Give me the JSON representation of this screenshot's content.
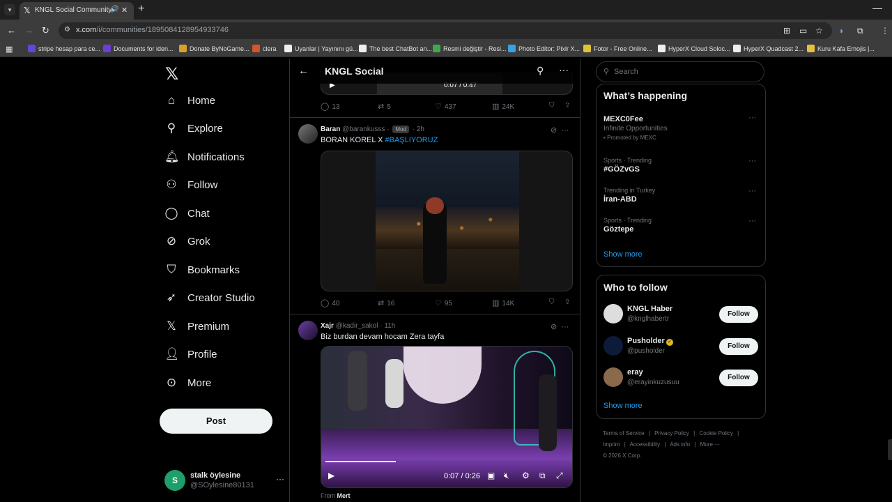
{
  "browser": {
    "tab_title": "KNGL Social Community / X",
    "url_host": "x.com",
    "url_path": "/i/communities/1895084128954933746",
    "bookmarks": [
      {
        "label": "stripe hesap para ce...",
        "color": "#5b4bd6"
      },
      {
        "label": "Documents for iden...",
        "color": "#6b3fd4"
      },
      {
        "label": "Donate ByNoGame...",
        "color": "#d9a12a"
      },
      {
        "label": "clera",
        "color": "#d4552a"
      },
      {
        "label": "Uyanlar | Yayınını gü...",
        "color": "#eeeeee"
      },
      {
        "label": "The best ChatBot an...",
        "color": "#eeeeee"
      },
      {
        "label": "Resmi değiştir - Resi...",
        "color": "#3fa84a"
      },
      {
        "label": "Photo Editor: Pixlr X...",
        "color": "#36a3e0"
      },
      {
        "label": "Fotor - Free Online...",
        "color": "#e0c236"
      },
      {
        "label": "HyperX Cloud Soloc...",
        "color": "#eeeeee"
      },
      {
        "label": "HyperX Quadcast 2...",
        "color": "#eeeeee"
      },
      {
        "label": "Kuru Kafa Emojis |...",
        "color": "#e6c23c"
      }
    ]
  },
  "nav": {
    "items": [
      {
        "label": "Home",
        "icon": "home-icon"
      },
      {
        "label": "Explore",
        "icon": "search-icon"
      },
      {
        "label": "Notifications",
        "icon": "bell-icon"
      },
      {
        "label": "Follow",
        "icon": "person-add-icon"
      },
      {
        "label": "Chat",
        "icon": "chat-icon"
      },
      {
        "label": "Grok",
        "icon": "grok-icon"
      },
      {
        "label": "Bookmarks",
        "icon": "bookmark-icon"
      },
      {
        "label": "Creator Studio",
        "icon": "rocket-icon"
      },
      {
        "label": "Premium",
        "icon": "x-icon"
      },
      {
        "label": "Profile",
        "icon": "person-icon"
      },
      {
        "label": "More",
        "icon": "more-circle-icon"
      }
    ],
    "post_label": "Post",
    "user": {
      "name": "stalk öylesine",
      "handle": "@SOylesine80131",
      "initial": "S"
    }
  },
  "community": {
    "title": "KNGL Social",
    "top_video": {
      "time": "0:07 / 0:47"
    },
    "top_stats": {
      "replies": "13",
      "reposts": "5",
      "likes": "437",
      "views": "24K"
    },
    "tweets": [
      {
        "name": "Baran",
        "handle": "@barankusss",
        "badge": "Mod",
        "time": "2h",
        "text": "BORAN KOREL X ",
        "hashtag": "#BAŞLIYORUZ",
        "stats": {
          "replies": "40",
          "reposts": "16",
          "likes": "95",
          "views": "14K"
        }
      },
      {
        "name": "Xajr",
        "handle": "@kadir_sakol",
        "time": "11h",
        "text": "Biz burdan devam hocam Zera tayfa",
        "video_time": "0:07 / 0:26",
        "video_progress": 0.29,
        "from_label": "From",
        "from_name": "Mert"
      }
    ]
  },
  "sidebar": {
    "search_placeholder": "Search",
    "whats_happening": "What’s happening",
    "trends": [
      {
        "title": "MEXC0Fee",
        "subtitle": "Infinite Opportunities",
        "promo": "Promoted by MEXC"
      },
      {
        "meta": "Sports · Trending",
        "title": "#GÖZvGS"
      },
      {
        "meta": "Trending in Turkey",
        "title": "İran-ABD"
      },
      {
        "meta": "Sports · Trending",
        "title": "Göztepe"
      }
    ],
    "show_more": "Show more",
    "who_to_follow": "Who to follow",
    "follow_label": "Follow",
    "suggestions": [
      {
        "name": "KNGL Haber",
        "handle": "@knglhabertr",
        "color": "#dddddd"
      },
      {
        "name": "Pusholder",
        "handle": "@pusholder",
        "color": "#0d1a3a",
        "verified": true
      },
      {
        "name": "eray",
        "handle": "@erayinkuzusuu",
        "color": "#8a6a4a"
      }
    ],
    "footer": [
      "Terms of Service",
      "|",
      "Privacy Policy",
      "|",
      "Cookie Policy",
      "|",
      "Imprint",
      "|",
      "Accessibility",
      "|",
      "Ads info",
      "|",
      "More ···",
      "© 2026 X Corp."
    ]
  }
}
